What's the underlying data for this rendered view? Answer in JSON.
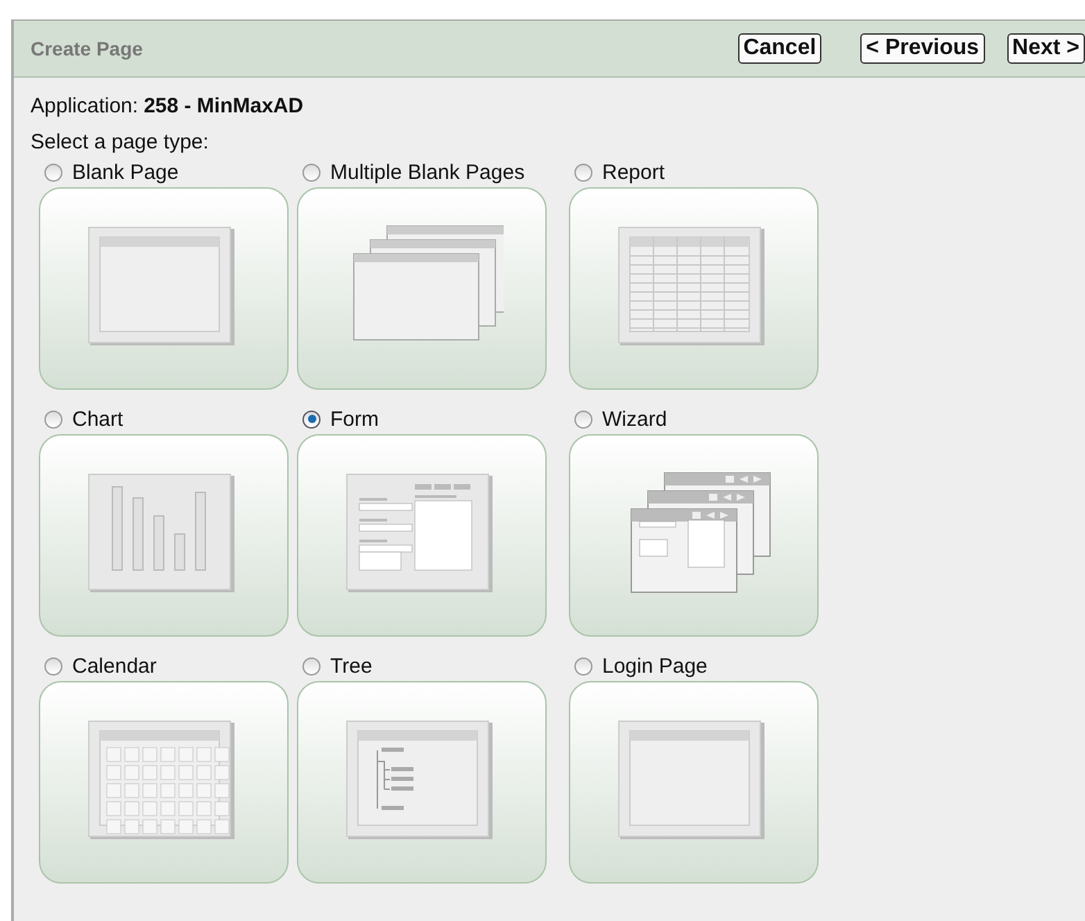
{
  "header": {
    "title": "Create Page",
    "buttons": [
      "Cancel",
      "< Previous",
      "Next >"
    ]
  },
  "application": {
    "label": "Application:",
    "value": "258 - MinMaxAD"
  },
  "prompt": "Select a page type:",
  "page_types": [
    {
      "label": "Blank Page",
      "kind": "blank",
      "selected": false
    },
    {
      "label": "Multiple Blank Pages",
      "kind": "multiple",
      "selected": false
    },
    {
      "label": "Report",
      "kind": "report",
      "selected": false
    },
    {
      "label": "Chart",
      "kind": "chart",
      "selected": false
    },
    {
      "label": "Form",
      "kind": "form",
      "selected": true
    },
    {
      "label": "Wizard",
      "kind": "wizard",
      "selected": false
    },
    {
      "label": "Calendar",
      "kind": "calendar",
      "selected": false
    },
    {
      "label": "Tree",
      "kind": "tree",
      "selected": false
    },
    {
      "label": "Login Page",
      "kind": "login",
      "selected": false
    }
  ]
}
